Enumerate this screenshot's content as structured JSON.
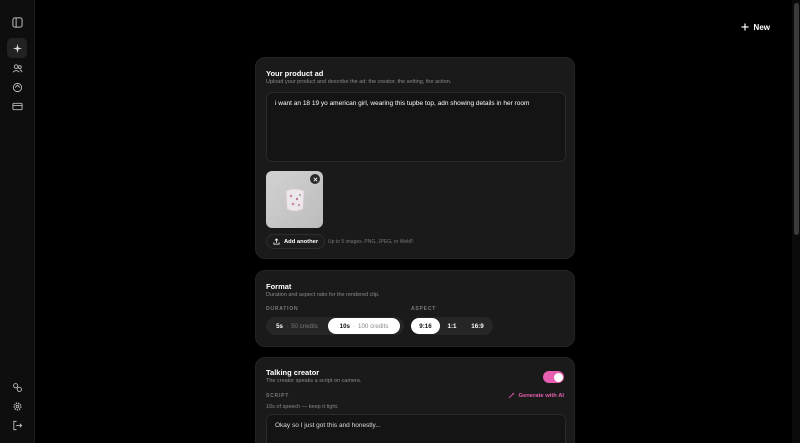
{
  "header": {
    "new_label": "New"
  },
  "sidebar": {
    "top_icons": [
      "panel-toggle-icon"
    ],
    "items": [
      {
        "icon": "sparkle-icon",
        "active": true
      },
      {
        "icon": "users-icon",
        "active": false
      },
      {
        "icon": "tag-icon",
        "active": false
      },
      {
        "icon": "card-icon",
        "active": false
      }
    ],
    "bottom_icons": [
      "link-icon",
      "gear-icon",
      "logout-icon"
    ]
  },
  "product_card": {
    "title": "Your product ad",
    "subtitle": "Upload your product and describe the ad: the creator, the setting, the action.",
    "prompt_value": "i want an 18 19 yo american girl, wearing this tupbe top, adn showing details in her room",
    "add_another_label": "Add another",
    "upload_hint": "Up to 5 images. PNG, JPEG, or WebP."
  },
  "format_card": {
    "title": "Format",
    "subtitle": "Duration and aspect ratio for the rendered clip.",
    "duration_label": "DURATION",
    "duration_options": [
      {
        "value": "5s",
        "credits": "50 credits",
        "selected": false
      },
      {
        "value": "10s",
        "credits": "100 credits",
        "selected": true
      }
    ],
    "aspect_label": "ASPECT",
    "aspect_options": [
      {
        "value": "9:16",
        "selected": true
      },
      {
        "value": "1:1",
        "selected": false
      },
      {
        "value": "16:9",
        "selected": false
      }
    ]
  },
  "talking_card": {
    "title": "Talking creator",
    "subtitle": "The creator speaks a script on camera.",
    "toggle_on": true,
    "script_label": "SCRIPT",
    "generate_label": "Generate with AI",
    "script_hint": "10s of speech — keep it tight.",
    "script_value": "Okay so I just got this and honestly..."
  },
  "colors": {
    "accent": "#e65fb0",
    "card_bg": "#1a1a1a",
    "page_bg": "#000000"
  }
}
